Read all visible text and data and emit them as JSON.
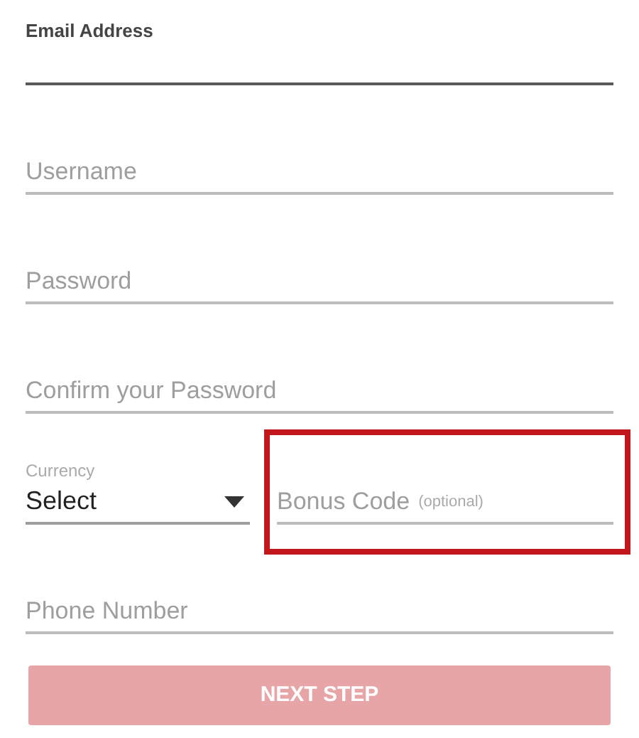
{
  "fields": [
    {
      "kind": "text",
      "label": "Email Address",
      "focused": true
    },
    {
      "kind": "text",
      "placeholder": "Username",
      "focused": false
    },
    {
      "kind": "text",
      "placeholder": "Password",
      "focused": false
    },
    {
      "kind": "text",
      "placeholder": "Confirm your Password",
      "focused": false
    }
  ],
  "currency": {
    "label": "Currency",
    "value": "Select"
  },
  "bonus": {
    "placeholder": "Bonus Code",
    "hint": "(optional)",
    "highlighted": true
  },
  "phone": {
    "placeholder": "Phone Number",
    "focused": false
  },
  "button": {
    "label": "NEXT STEP",
    "disabled": true
  }
}
